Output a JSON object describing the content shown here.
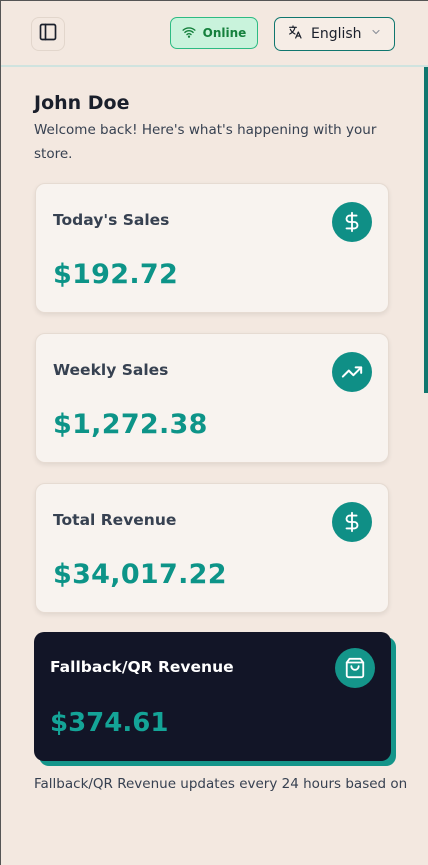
{
  "header": {
    "status_label": "Online",
    "language_label": "English"
  },
  "user": {
    "name": "John Doe",
    "welcome": "Welcome back! Here's what's happening with your store."
  },
  "cards": [
    {
      "title": "Today's Sales",
      "value": "$192.72",
      "icon": "dollar-icon"
    },
    {
      "title": "Weekly Sales",
      "value": "$1,272.38",
      "icon": "trending-up-icon"
    },
    {
      "title": "Total Revenue",
      "value": "$34,017.22",
      "icon": "dollar-icon"
    }
  ],
  "fallback_card": {
    "title": "Fallback/QR Revenue",
    "value": "$374.61",
    "icon": "shopping-bag-icon"
  },
  "footnote": "Fallback/QR Revenue updates every 24 hours based on",
  "colors": {
    "accent": "#0d9488",
    "background": "#f3e8e0",
    "dark_card": "#121527",
    "online_bg": "#c9f3dc"
  }
}
